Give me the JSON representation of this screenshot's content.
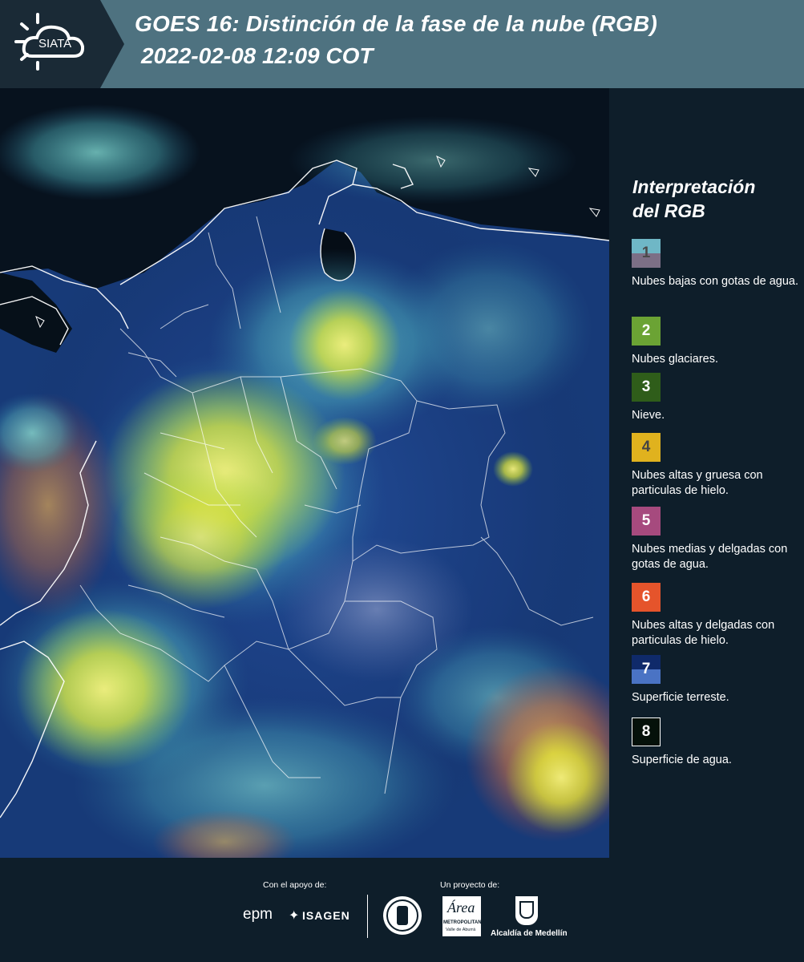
{
  "header": {
    "logo_text": "SIATA",
    "title_line1": "GOES 16: Distinción de la fase de la nube (RGB)",
    "title_line2": "2022-02-08 12:09 COT"
  },
  "legend": {
    "title_line1": "Interpretación",
    "title_line2": "del RGB",
    "items": [
      {
        "number": "1",
        "label": "Nubes bajas con gotas de agua.",
        "color_top": "#6fb7c6",
        "color_bottom": "#7c6f86",
        "number_color": "#4a4a4a"
      },
      {
        "number": "2",
        "label": "Nubes glaciares.",
        "color_top": "#6ba334",
        "color_bottom": "#6ba334",
        "number_color": "#ffffff"
      },
      {
        "number": "3",
        "label": "Nieve.",
        "color_top": "#2f5d1a",
        "color_bottom": "#2f5d1a",
        "number_color": "#ffffff"
      },
      {
        "number": "4",
        "label": "Nubes altas y gruesa con particulas de hielo.",
        "color_top": "#e0b21e",
        "color_bottom": "#e0b21e",
        "number_color": "#444444"
      },
      {
        "number": "5",
        "label": "Nubes medias y delgadas con gotas de agua.",
        "color_top": "#a64a7e",
        "color_bottom": "#a64a7e",
        "number_color": "#ffffff"
      },
      {
        "number": "6",
        "label": "Nubes altas y delgadas con particulas de hielo.",
        "color_top": "#e5542b",
        "color_bottom": "#e5542b",
        "number_color": "#ffffff"
      },
      {
        "number": "7",
        "label": "Superficie terreste.",
        "color_top": "#0f2a6a",
        "color_bottom": "#4a73c4",
        "number_color": "#ffffff"
      },
      {
        "number": "8",
        "label": "Superficie de agua.",
        "color_top": "#05110a",
        "color_bottom": "#05110a",
        "number_color": "#ffffff"
      }
    ]
  },
  "footer": {
    "support_caption": "Con el apoyo de:",
    "project_caption": "Un proyecto de:",
    "sponsor1": "epm",
    "sponsor2": "ISAGEN",
    "partner1": "METROPOLITANA",
    "partner1_sub": "Valle de Aburrá",
    "partner2": "Alcaldía de Medellín"
  }
}
